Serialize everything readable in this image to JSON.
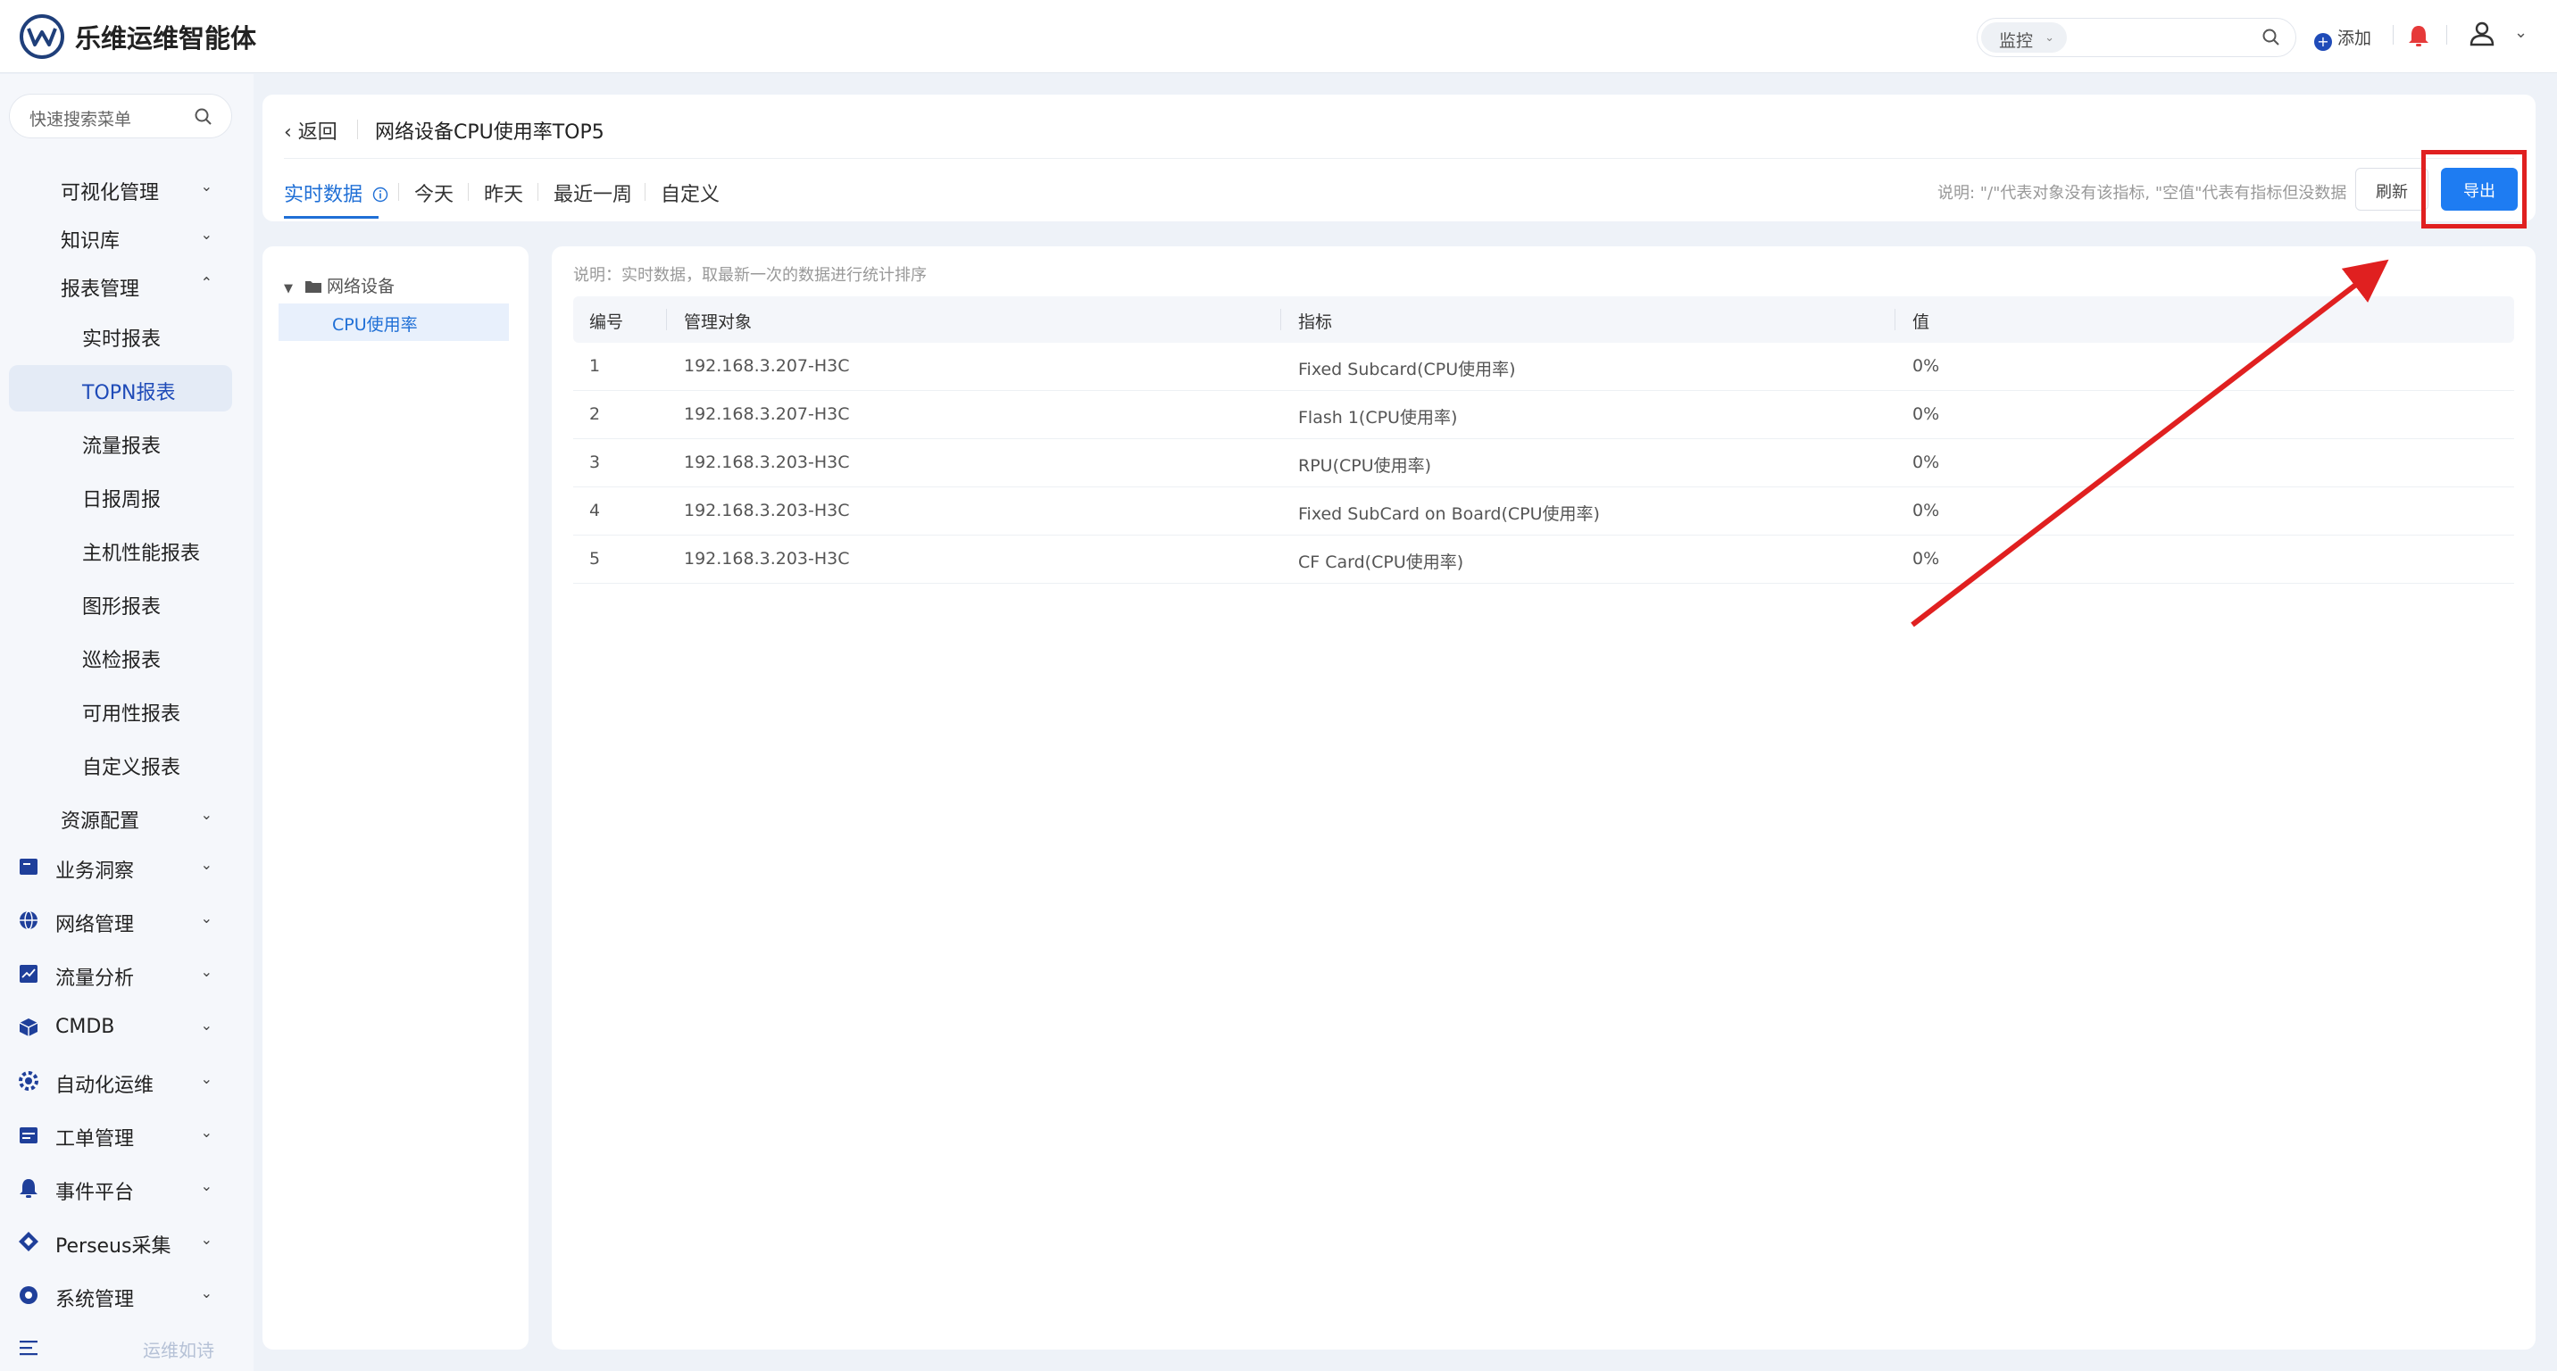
{
  "header": {
    "app_title": "乐维运维智能体",
    "search_scope": "监控",
    "add_label": "添加"
  },
  "sidebar": {
    "search_placeholder": "快速搜索菜单",
    "items": [
      {
        "label": "可视化管理",
        "arrow": "⌄"
      },
      {
        "label": "知识库",
        "arrow": "⌄"
      },
      {
        "label": "报表管理",
        "arrow": "⌃"
      },
      {
        "label": "实时报表"
      },
      {
        "label": "TOPN报表"
      },
      {
        "label": "流量报表"
      },
      {
        "label": "日报周报"
      },
      {
        "label": "主机性能报表"
      },
      {
        "label": "图形报表"
      },
      {
        "label": "巡检报表"
      },
      {
        "label": "可用性报表"
      },
      {
        "label": "自定义报表"
      },
      {
        "label": "资源配置",
        "arrow": "⌄"
      },
      {
        "label": "业务洞察",
        "arrow": "⌄"
      },
      {
        "label": "网络管理",
        "arrow": "⌄"
      },
      {
        "label": "流量分析",
        "arrow": "⌄"
      },
      {
        "label": "CMDB",
        "arrow": "⌄"
      },
      {
        "label": "自动化运维",
        "arrow": "⌄"
      },
      {
        "label": "工单管理",
        "arrow": "⌄"
      },
      {
        "label": "事件平台",
        "arrow": "⌄"
      },
      {
        "label": "Perseus采集",
        "arrow": "⌄"
      },
      {
        "label": "系统管理",
        "arrow": "⌄"
      }
    ],
    "slogan": "运维如诗"
  },
  "toolbar": {
    "back_label": "返回",
    "page_title": "网络设备CPU使用率TOP5",
    "tabs": [
      "实时数据",
      "今天",
      "昨天",
      "最近一周",
      "自定义"
    ],
    "note": "说明: \"/\"代表对象没有该指标, \"空值\"代表有指标但没数据",
    "refresh_label": "刷新",
    "export_label": "导出"
  },
  "tree": {
    "root": "网络设备",
    "child": "CPU使用率"
  },
  "table": {
    "note": "说明：实时数据，取最新一次的数据进行统计排序",
    "headers": [
      "编号",
      "管理对象",
      "指标",
      "值"
    ],
    "rows": [
      [
        "1",
        "192.168.3.207-H3C",
        "Fixed Subcard(CPU使用率)",
        "0%"
      ],
      [
        "2",
        "192.168.3.207-H3C",
        "Flash 1(CPU使用率)",
        "0%"
      ],
      [
        "3",
        "192.168.3.203-H3C",
        "RPU(CPU使用率)",
        "0%"
      ],
      [
        "4",
        "192.168.3.203-H3C",
        "Fixed SubCard on Board(CPU使用率)",
        "0%"
      ],
      [
        "5",
        "192.168.3.203-H3C",
        "CF Card(CPU使用率)",
        "0%"
      ]
    ]
  },
  "colors": {
    "accent": "#1e7cf2",
    "highlight": "#e02020",
    "brand": "#1f3f7a"
  }
}
